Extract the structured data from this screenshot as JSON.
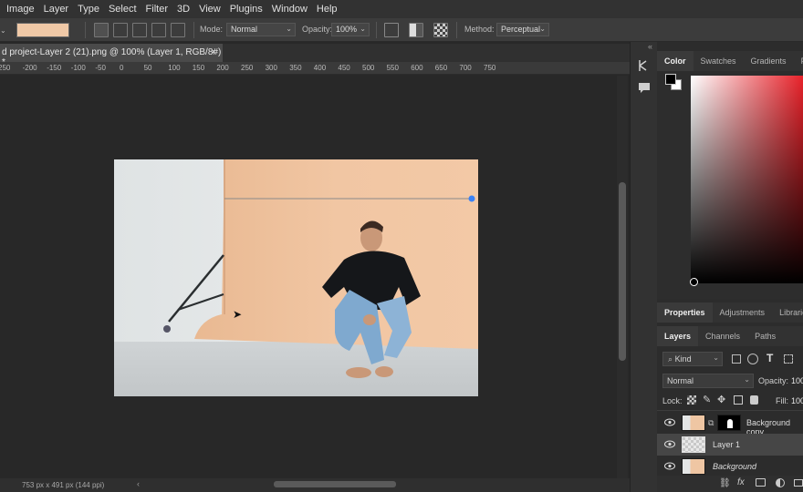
{
  "menu": [
    "Image",
    "Layer",
    "Type",
    "Select",
    "Filter",
    "3D",
    "View",
    "Plugins",
    "Window",
    "Help"
  ],
  "options": {
    "mode_label": "Mode:",
    "mode_value": "Normal",
    "opacity_label": "Opacity:",
    "opacity_value": "100%",
    "method_label": "Method:",
    "method_value": "Perceptual",
    "gradient_color": "#f0c9a7"
  },
  "document": {
    "tab_title": "d project-Layer 2 (21).png @ 100% (Layer 1, RGB/8#) *",
    "close_glyph": "×",
    "status": "753 px x 491 px (144 ppi)"
  },
  "ruler_ticks": [
    "250",
    "-200",
    "-150",
    "-100",
    "-50",
    "0",
    "50",
    "100",
    "150",
    "200",
    "250",
    "300",
    "350",
    "400",
    "450",
    "500",
    "550",
    "600",
    "650",
    "700",
    "750"
  ],
  "color_panel": {
    "tabs": [
      "Color",
      "Swatches",
      "Gradients",
      "Patte"
    ],
    "active": "Color",
    "hue_color": "#e8222a"
  },
  "properties_tabs": [
    "Properties",
    "Adjustments",
    "Libraries"
  ],
  "layers_panel": {
    "tabs": [
      "Layers",
      "Channels",
      "Paths"
    ],
    "filter_label": "Kind",
    "blend_mode": "Normal",
    "opacity_label": "Opacity:",
    "opacity_value": "100",
    "lock_label": "Lock:",
    "fill_label": "Fill:",
    "fill_value": "100",
    "layers": [
      {
        "name": "Background copy",
        "italic": false,
        "selected": false
      },
      {
        "name": "Layer 1",
        "italic": false,
        "selected": true
      },
      {
        "name": "Background",
        "italic": true,
        "selected": false
      }
    ]
  }
}
